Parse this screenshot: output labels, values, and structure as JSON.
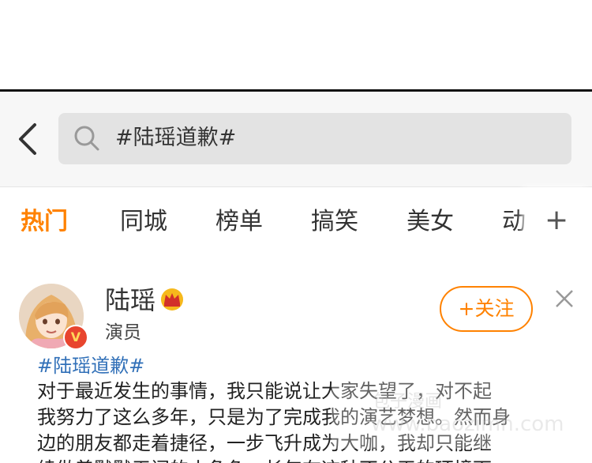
{
  "search": {
    "query": "#陆瑶道歉#"
  },
  "tabs": [
    {
      "label": "热门",
      "active": true
    },
    {
      "label": "同城"
    },
    {
      "label": "榜单"
    },
    {
      "label": "搞笑"
    },
    {
      "label": "美女"
    },
    {
      "label": "动"
    }
  ],
  "tabs_add_label": "+",
  "post": {
    "user_name": "陆瑶",
    "user_role": "演员",
    "follow_label": "+关注",
    "hashtag": "#陆瑶道歉#",
    "lines": [
      "对于最近发生的事情，我只能说让大家失望了，对不起",
      "我努力了这么多年，只是为了完成我的演艺梦想。然而身",
      "边的朋友都走着捷径，一步飞升成为大咖，我却只能继",
      "续做着默默无闻的小角色，长年在这种不公平的环境下"
    ]
  },
  "watermark": {
    "url": "www.baozimh.com",
    "text": "包子漫画"
  },
  "colors": {
    "accent": "#ff8200",
    "hashtag": "#3170b8",
    "badge": "#e8452e"
  },
  "icons": [
    "back-arrow-icon",
    "search-icon",
    "crown-icon",
    "close-icon",
    "verified-badge-icon"
  ]
}
